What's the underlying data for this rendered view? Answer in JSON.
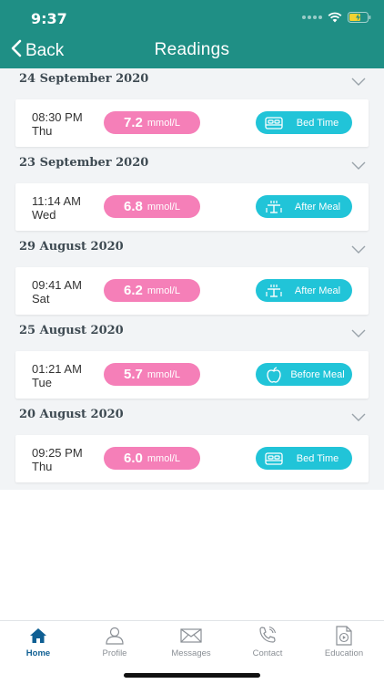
{
  "status_bar": {
    "time": "9:37"
  },
  "nav": {
    "back_label": "Back",
    "title": "Readings"
  },
  "colors": {
    "header": "#1f8f85",
    "glucose_pill": "#f57fb8",
    "meal_pill": "#21c4d8",
    "active_tab": "#0f5f93"
  },
  "groups": [
    {
      "date": "24 September 2020",
      "reading": {
        "time": "08:30 PM",
        "day": "Thu",
        "value": "7.2",
        "unit": "mmol/L",
        "meal": "Bed Time",
        "meal_icon": "bed-icon"
      }
    },
    {
      "date": "23 September 2020",
      "reading": {
        "time": "11:14 AM",
        "day": "Wed",
        "value": "6.8",
        "unit": "mmol/L",
        "meal": "After Meal",
        "meal_icon": "dining-table-icon"
      }
    },
    {
      "date": "29 August 2020",
      "reading": {
        "time": "09:41 AM",
        "day": "Sat",
        "value": "6.2",
        "unit": "mmol/L",
        "meal": "After Meal",
        "meal_icon": "dining-table-icon"
      }
    },
    {
      "date": "25 August 2020",
      "reading": {
        "time": "01:21 AM",
        "day": "Tue",
        "value": "5.7",
        "unit": "mmol/L",
        "meal": "Before Meal",
        "meal_icon": "apple-icon"
      }
    },
    {
      "date": "20 August 2020",
      "reading": {
        "time": "09:25 PM",
        "day": "Thu",
        "value": "6.0",
        "unit": "mmol/L",
        "meal": "Bed Time",
        "meal_icon": "bed-icon"
      }
    }
  ],
  "tabs": [
    {
      "label": "Home",
      "icon": "home-icon",
      "active": true
    },
    {
      "label": "Profile",
      "icon": "user-icon",
      "active": false
    },
    {
      "label": "Messages",
      "icon": "envelope-icon",
      "active": false
    },
    {
      "label": "Contact",
      "icon": "phone-icon",
      "active": false
    },
    {
      "label": "Education",
      "icon": "video-document-icon",
      "active": false
    }
  ]
}
